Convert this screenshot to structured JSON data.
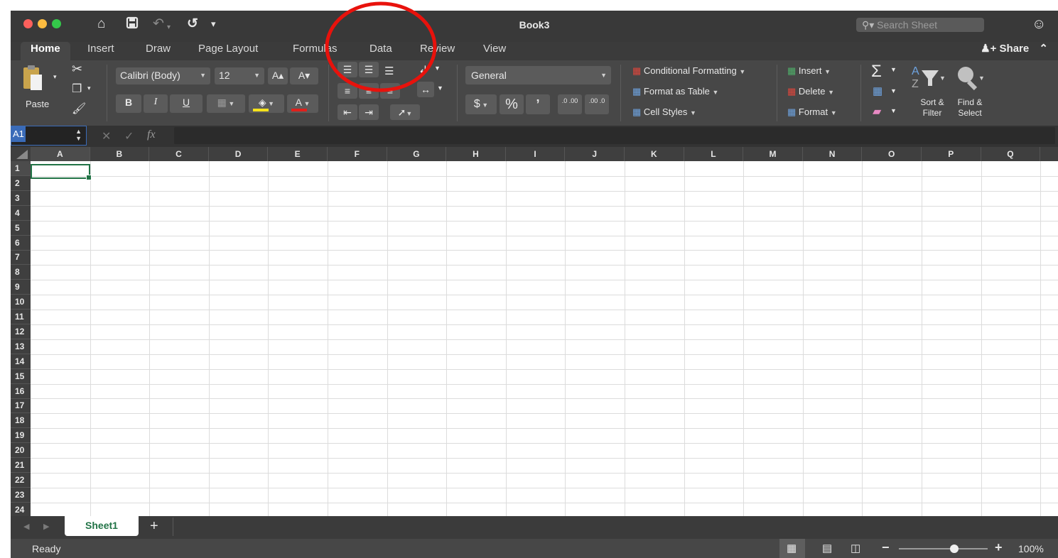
{
  "titlebar": {
    "title": "Book3",
    "search_placeholder": "Search Sheet",
    "icons": [
      "home-icon",
      "save-icon",
      "undo-icon",
      "redo-icon",
      "customize-toolbar-icon",
      "smiley-icon"
    ]
  },
  "tabs": [
    "Home",
    "Insert",
    "Draw",
    "Page Layout",
    "Formulas",
    "Data",
    "Review",
    "View"
  ],
  "active_tab": "Home",
  "share_label": "Share",
  "ribbon": {
    "paste_label": "Paste",
    "font_name": "Calibri (Body)",
    "font_size": "12",
    "number_format": "General",
    "currency_symbol": "$",
    "percent_symbol": "%",
    "comma_symbol": "’",
    "inc_decimal": ".0 .00",
    "dec_decimal": ".00 .0",
    "bold": "B",
    "italic": "I",
    "underline": "U",
    "grow_font": "A▴",
    "shrink_font": "A▾",
    "font_color": "A",
    "conditional_formatting": "Conditional Formatting",
    "format_as_table": "Format as Table",
    "cell_styles": "Cell Styles",
    "insert": "Insert",
    "delete": "Delete",
    "format": "Format",
    "sort_filter": "Sort & Filter",
    "sort_filter_l1": "Sort &",
    "sort_filter_l2": "Filter",
    "find_select_l1": "Find &",
    "find_select_l2": "Select",
    "highlight_color": "#f5e21b",
    "font_color_value": "#e0201b"
  },
  "formula_bar": {
    "name_box": "A1",
    "fx": "fx",
    "value": ""
  },
  "columns": [
    "A",
    "B",
    "C",
    "D",
    "E",
    "F",
    "G",
    "H",
    "I",
    "J",
    "K",
    "L",
    "M",
    "N",
    "O",
    "P",
    "Q"
  ],
  "rows": [
    "1",
    "2",
    "3",
    "4",
    "5",
    "6",
    "7",
    "8",
    "9",
    "10",
    "11",
    "12",
    "13",
    "14",
    "15",
    "16",
    "17",
    "18",
    "19",
    "20",
    "21",
    "22",
    "23",
    "24"
  ],
  "selected_cell": "A1",
  "sheets": [
    "Sheet1"
  ],
  "active_sheet": "Sheet1",
  "status": {
    "text": "Ready",
    "zoom": "100%",
    "zoom_level": 1.0
  },
  "annotation_color": "#e8120c"
}
